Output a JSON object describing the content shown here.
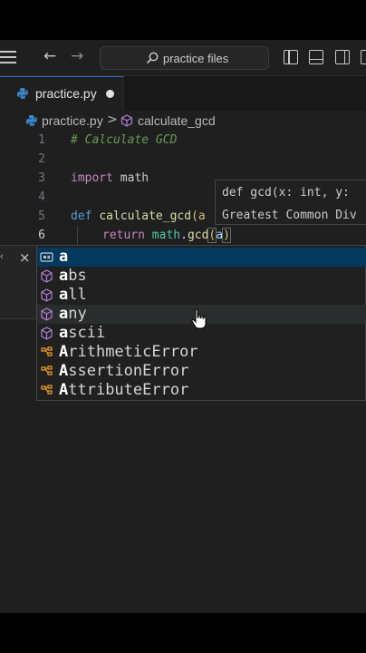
{
  "titlebar": {
    "search_placeholder": "practice files"
  },
  "tab": {
    "filename": "practice.py",
    "modified": true
  },
  "breadcrumb": {
    "file": "practice.py",
    "separator": ">",
    "symbol": "calculate_gcd"
  },
  "code": {
    "lines": [
      {
        "number": "1",
        "text": "# Calculate GCD"
      },
      {
        "number": "2",
        "text": ""
      },
      {
        "number": "3",
        "kw": "import",
        "rest": " math"
      },
      {
        "number": "4",
        "text": ""
      },
      {
        "number": "5",
        "kw": "def",
        "fn": "calculate_gcd",
        "rest": "(a"
      },
      {
        "number": "6",
        "kw": "return",
        "mod": "math",
        "fn": "gcd",
        "arg": "a"
      }
    ]
  },
  "hover": {
    "signature": "def gcd(x: int, y:",
    "doc": "Greatest Common Div"
  },
  "suggestions": [
    {
      "kind": "variable",
      "match": "a",
      "rest": ""
    },
    {
      "kind": "function",
      "match": "a",
      "rest": "bs"
    },
    {
      "kind": "function",
      "match": "a",
      "rest": "ll"
    },
    {
      "kind": "function",
      "match": "a",
      "rest": "ny"
    },
    {
      "kind": "function",
      "match": "a",
      "rest": "scii"
    },
    {
      "kind": "class",
      "match": "A",
      "rest": "rithmeticError"
    },
    {
      "kind": "class",
      "match": "A",
      "rest": "ssertionError"
    },
    {
      "kind": "class",
      "match": "A",
      "rest": "ttributeError"
    }
  ],
  "colors": {
    "editor_bg": "#1f1f1f",
    "focus_row": "#04395e",
    "keyword": "#c586c0",
    "function": "#dcdcaa",
    "comment": "#6a9955",
    "symbol_icon": "#b180d7",
    "class_icon": "#ee9d28"
  }
}
